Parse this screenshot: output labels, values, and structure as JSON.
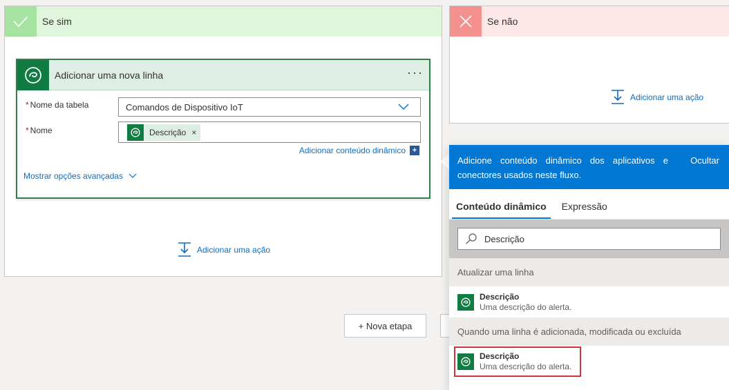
{
  "branch_yes": {
    "title": "Se sim"
  },
  "branch_no": {
    "title": "Se não",
    "add_action_label": "Adicionar uma ação"
  },
  "card": {
    "title": "Adicionar uma nova linha",
    "menu_label": "···",
    "table_field": {
      "label": "Nome da tabela",
      "required_mark": "*",
      "value": "Comandos de Dispositivo IoT"
    },
    "name_field": {
      "label": "Nome",
      "required_mark": "*",
      "token_label": "Descrição",
      "token_remove": "×"
    },
    "add_dynamic_label": "Adicionar conteúdo dinâmico",
    "add_dynamic_plus": "+",
    "advanced_label": "Mostrar opções avançadas"
  },
  "yes_add_action_label": "Adicionar uma ação",
  "new_step_label": "+ Nova etapa",
  "flyout": {
    "header_text": "Adicione conteúdo dinâmico dos aplicativos e conectores usados neste fluxo.",
    "hide_label": "Ocultar",
    "tabs": [
      {
        "label": "Conteúdo dinâmico",
        "active": true
      },
      {
        "label": "Expressão",
        "active": false
      }
    ],
    "search_value": "Descrição",
    "sections": [
      {
        "title": "Atualizar uma linha",
        "items": [
          {
            "name": "Descrição",
            "desc": "Uma descrição do alerta.",
            "highlighted": false
          }
        ]
      },
      {
        "title": "Quando uma linha é adicionada, modificada ou excluída",
        "items": [
          {
            "name": "Descrição",
            "desc": "Uma descrição do alerta.",
            "highlighted": true
          }
        ]
      }
    ]
  },
  "colors": {
    "accent": "#0078d4",
    "dataverse_green": "#107c41",
    "link": "#0f6cbd",
    "highlight": "#d13438"
  },
  "icons": [
    "check-icon",
    "close-icon",
    "dataverse-icon",
    "chevron-down-icon",
    "add-action-icon",
    "search-icon"
  ]
}
